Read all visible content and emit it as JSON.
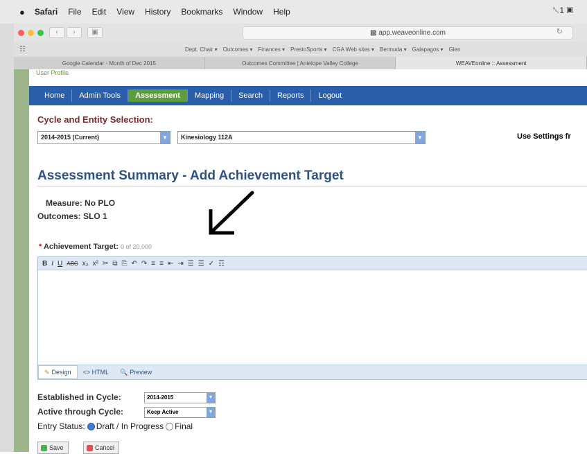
{
  "menubar": {
    "app": "Safari",
    "items": [
      "File",
      "Edit",
      "View",
      "History",
      "Bookmarks",
      "Window",
      "Help"
    ],
    "right_status": "␀1 ▣"
  },
  "browser": {
    "url": "app.weaveonline.com",
    "favorites": [
      "Dept. Chair ▾",
      "Outcomes ▾",
      "Finances ▾",
      "PrestoSports ▾",
      "CGA Web sites ▾",
      "Bermuda ▾",
      "Galapagos ▾",
      "Glen"
    ],
    "tabs": [
      "Google Calendar - Month of Dec 2015",
      "Outcomes Committee | Antelope Valley College",
      "WEAVEonline :: Assessment"
    ],
    "active_tab": 2
  },
  "header": {
    "user_link": "User Profile"
  },
  "nav": {
    "items": [
      "Home",
      "Admin Tools",
      "Assessment",
      "Mapping",
      "Search",
      "Reports",
      "Logout"
    ],
    "active": 2
  },
  "selection": {
    "title": "Cycle and Entity Selection:",
    "cycle": "2014-2015  (Current)",
    "entity": "Kinesiology 112A",
    "use_settings": "Use Settings fr"
  },
  "page": {
    "title": "Assessment Summary - Add Achievement Target",
    "measure_label": "Measure:",
    "measure_value": "No PLO",
    "outcomes_label": "Outcomes:",
    "outcomes_value": "SLO 1"
  },
  "target": {
    "required_mark": "*",
    "label": "Achievement Target:",
    "counter": "0 of 20,000"
  },
  "editor": {
    "toolbar": [
      "B",
      "I",
      "U",
      "ABC",
      "x₂",
      "x²",
      "✂",
      "⧉",
      "⎘",
      "↶",
      "↷",
      "≡",
      "≡",
      "⇤",
      "⇥",
      "☰",
      "☰",
      "✓",
      "☶"
    ],
    "modes": [
      "Design",
      "<> HTML",
      "Preview"
    ],
    "mode_icons": [
      "✎",
      "‹›",
      "🔍"
    ]
  },
  "established": {
    "label": "Established in Cycle:",
    "value": "2014-2015"
  },
  "active_through": {
    "label": "Active through Cycle:",
    "value": "Keep Active"
  },
  "entry_status": {
    "label": "Entry Status:",
    "options": [
      "Draft / In Progress",
      "Final"
    ],
    "selected": 0
  },
  "buttons": {
    "save": "Save",
    "cancel": "Cancel"
  },
  "colors": {
    "nav_bg": "#2a5ea8",
    "nav_active": "#5d9e3c",
    "title": "#2c5286",
    "section_title": "#7a2c2c"
  }
}
